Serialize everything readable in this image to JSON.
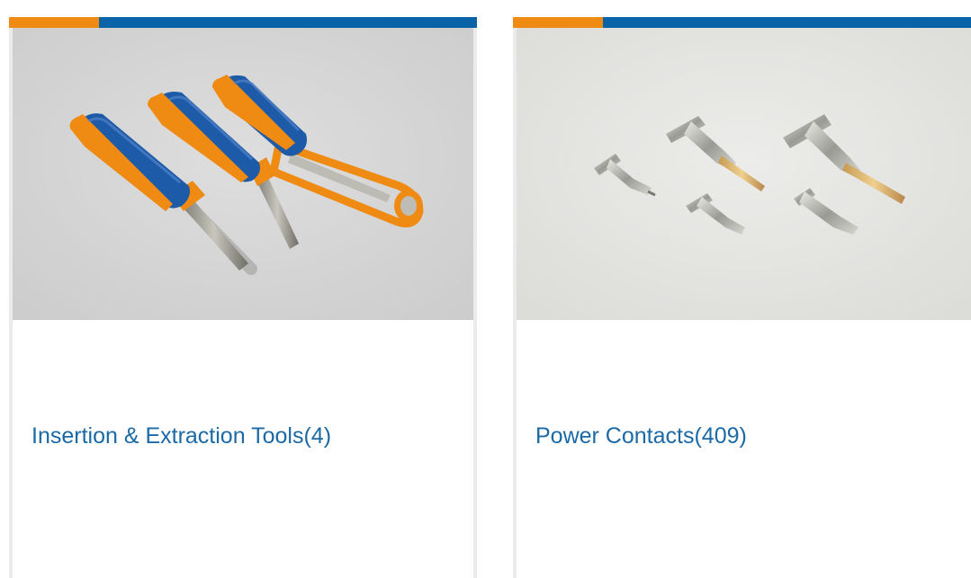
{
  "colors": {
    "accent_orange": "#ef8a12",
    "accent_blue": "#0a63a6",
    "link_blue": "#1b6aa6",
    "card_border": "#ebebeb"
  },
  "cards": [
    {
      "title": "Insertion & Extraction Tools(4)",
      "image_icon": "insertion-extraction-tools-photo"
    },
    {
      "title": "Power Contacts(409)",
      "image_icon": "power-contacts-photo"
    }
  ]
}
